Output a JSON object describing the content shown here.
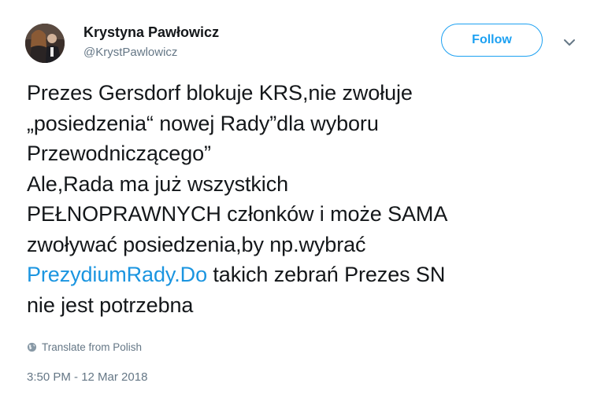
{
  "author": {
    "name": "Krystyna Pawłowicz",
    "handle": "@KrystPawlowicz"
  },
  "follow_label": "Follow",
  "tweet": {
    "line1": "Prezes Gersdorf blokuje KRS,nie zwołuje",
    "line2": "„posiedzenia“ nowej Rady”dla wyboru",
    "line3": "Przewodniczącego”",
    "line4": "Ale,Rada ma już wszystkich",
    "line5": "PEŁNOPRAWNYCH członków i może SAMA",
    "line6": "zwoływać posiedzenia,by np.wybrać",
    "line7_link": "PrezydiumRady.Do",
    "line7_rest": " takich zebrań Prezes SN",
    "line8": "nie jest potrzebna"
  },
  "translate_label": "Translate from Polish",
  "timestamp": "3:50 PM - 12 Mar 2018",
  "colors": {
    "accent": "#1da1f2",
    "link": "#1b95e0",
    "muted": "#657786",
    "text": "#14171a"
  },
  "icons": [
    "avatar",
    "chevron-down-icon",
    "globe-icon"
  ]
}
